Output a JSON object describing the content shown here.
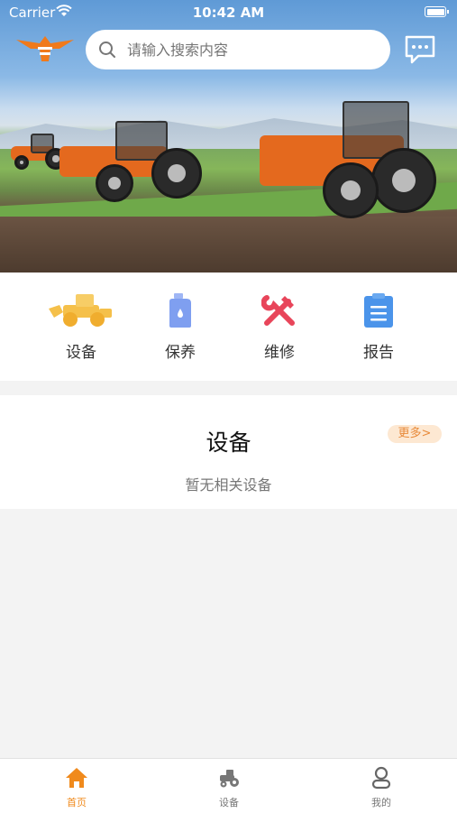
{
  "status_bar": {
    "carrier": "Carrier",
    "time": "10:42 AM"
  },
  "header": {
    "search_placeholder": "请输入搜索内容",
    "logo_icon": "eagle-logo-icon",
    "message_icon": "message-bubble-icon"
  },
  "menu": {
    "items": [
      {
        "label": "设备",
        "icon": "loader-vehicle-icon",
        "color": "#f5c04a"
      },
      {
        "label": "保养",
        "icon": "oil-bottle-icon",
        "color": "#7f9ff0"
      },
      {
        "label": "维修",
        "icon": "wrench-screwdriver-icon",
        "color": "#e8455a"
      },
      {
        "label": "报告",
        "icon": "clipboard-report-icon",
        "color": "#4b94ea"
      }
    ]
  },
  "device_section": {
    "title": "设备",
    "more": "更多>",
    "empty_text": "暂无相关设备"
  },
  "tabbar": {
    "tabs": [
      {
        "label": "首页",
        "icon": "home-icon",
        "active": true
      },
      {
        "label": "设备",
        "icon": "tractor-icon",
        "active": false
      },
      {
        "label": "我的",
        "icon": "user-icon",
        "active": false
      }
    ],
    "active_color": "#f08a1c"
  }
}
